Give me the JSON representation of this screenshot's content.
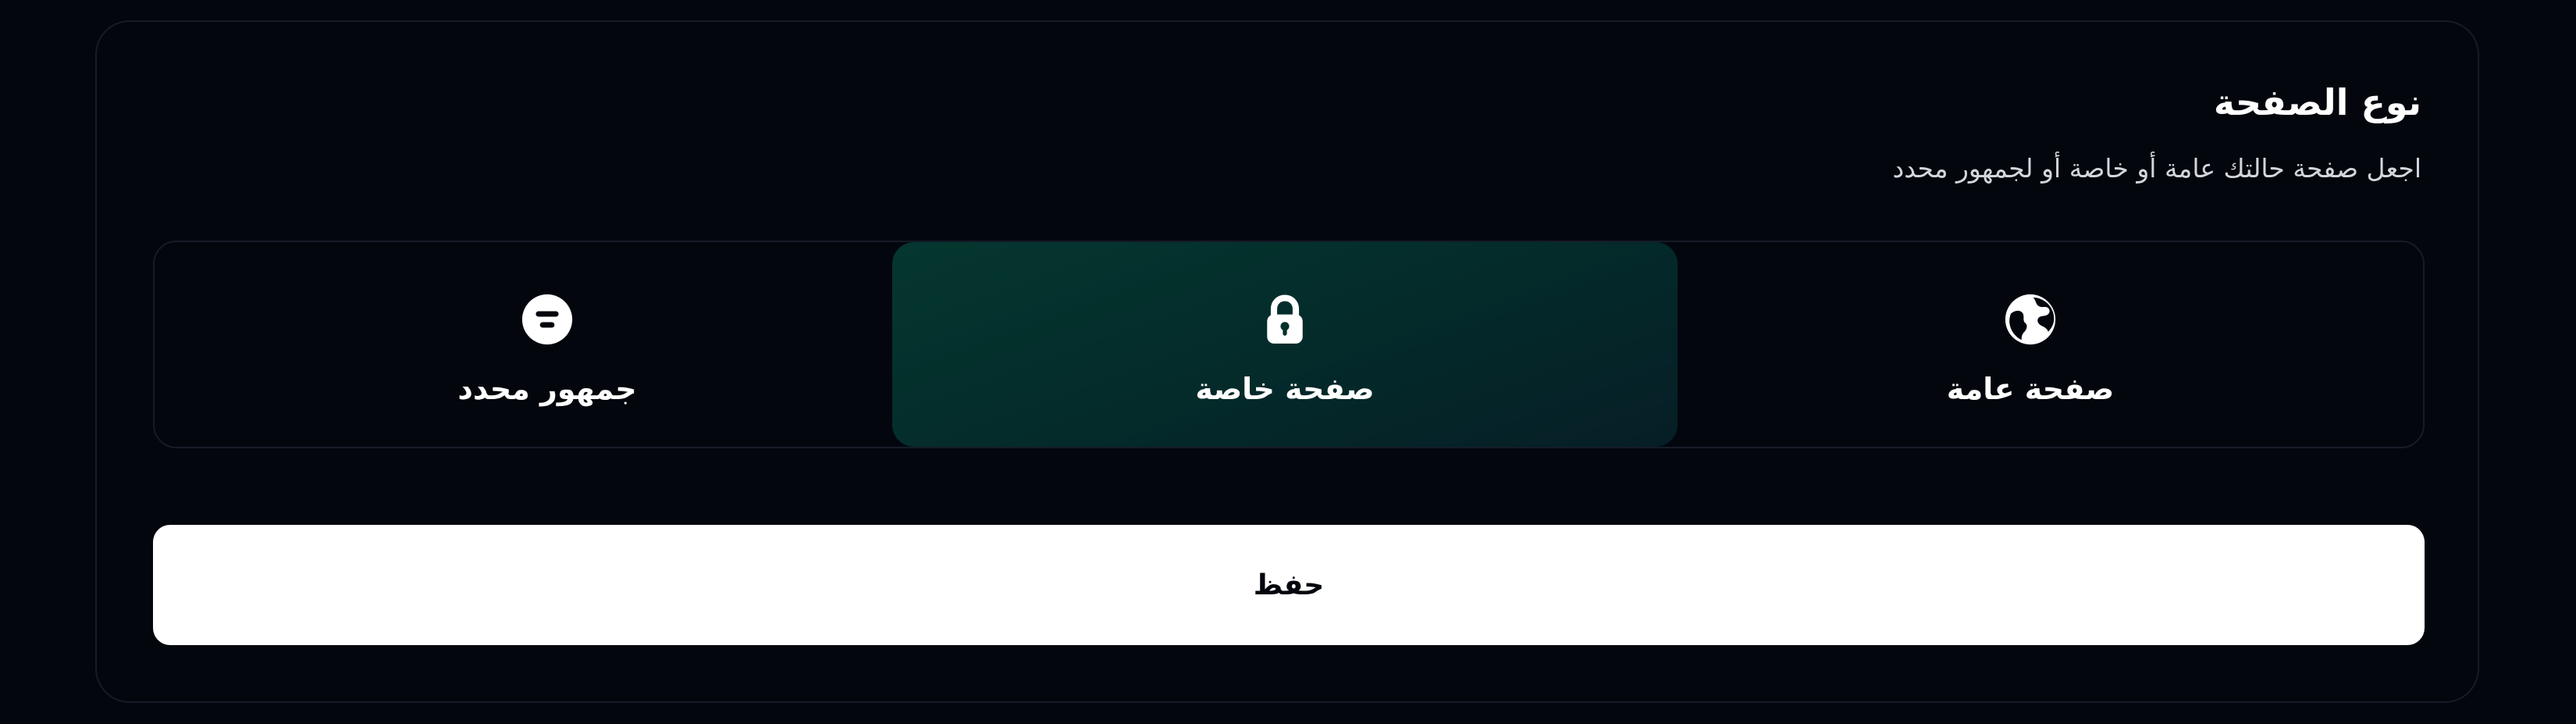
{
  "section": {
    "title": "نوع الصفحة",
    "subtitle": "اجعل صفحة حالتك عامة أو خاصة أو لجمهور محدد"
  },
  "options": [
    {
      "label": "صفحة عامة",
      "icon": "globe-icon",
      "selected": false
    },
    {
      "label": "صفحة خاصة",
      "icon": "lock-icon",
      "selected": true
    },
    {
      "label": "جمهور محدد",
      "icon": "filter-icon",
      "selected": false
    }
  ],
  "save_button": {
    "label": "حفظ"
  },
  "colors": {
    "background": "#03060d",
    "border": "#161b27",
    "selected_bg": "#05372f",
    "button_bg": "#ffffff",
    "text": "#ffffff"
  }
}
